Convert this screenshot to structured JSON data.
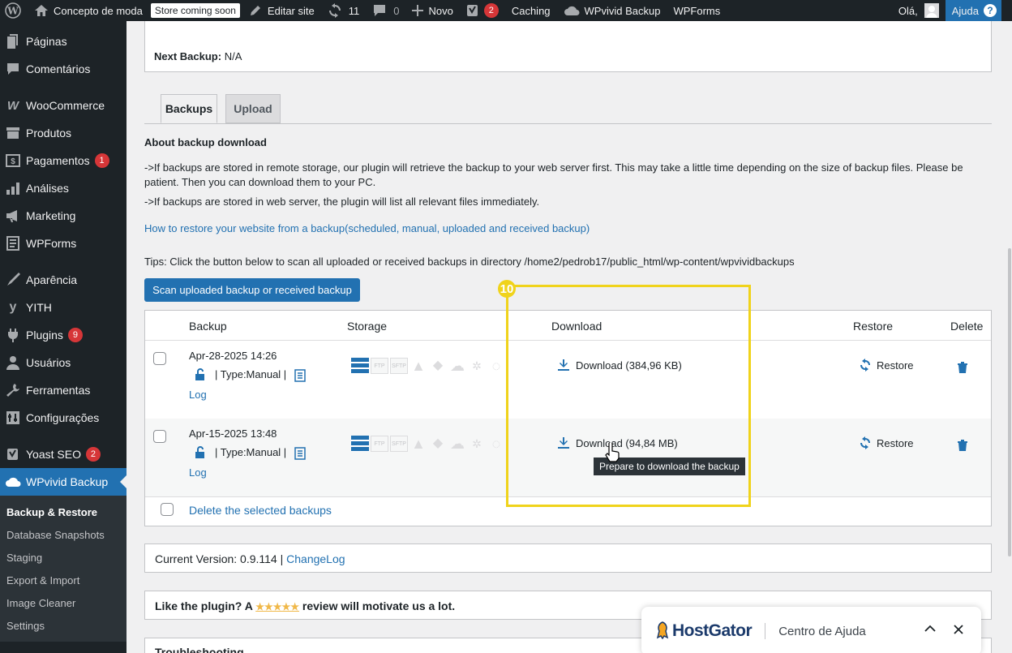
{
  "adminbar": {
    "site_name": "Concepto de moda",
    "store_badge": "Store coming soon",
    "edit_site": "Editar site",
    "updates_count": "11",
    "comments_count": "0",
    "new_label": "Novo",
    "yoast_count": "2",
    "caching": "Caching",
    "wpvivid": "WPvivid Backup",
    "wpforms": "WPForms",
    "greeting": "Olá,",
    "help": "Ajuda"
  },
  "sidebar": {
    "items": [
      {
        "label": "Páginas",
        "icon": "pages-icon"
      },
      {
        "label": "Comentários",
        "icon": "comments-icon"
      },
      {
        "label": "WooCommerce",
        "icon": "woocommerce-icon"
      },
      {
        "label": "Produtos",
        "icon": "products-icon"
      },
      {
        "label": "Pagamentos",
        "icon": "payments-icon",
        "badge": "1"
      },
      {
        "label": "Análises",
        "icon": "analytics-icon"
      },
      {
        "label": "Marketing",
        "icon": "marketing-icon"
      },
      {
        "label": "WPForms",
        "icon": "wpforms-icon"
      },
      {
        "label": "Aparência",
        "icon": "appearance-icon"
      },
      {
        "label": "YITH",
        "icon": "yith-icon"
      },
      {
        "label": "Plugins",
        "icon": "plugins-icon",
        "badge": "9"
      },
      {
        "label": "Usuários",
        "icon": "users-icon"
      },
      {
        "label": "Ferramentas",
        "icon": "tools-icon"
      },
      {
        "label": "Configurações",
        "icon": "settings-icon"
      },
      {
        "label": "Yoast SEO",
        "icon": "yoast-icon",
        "badge": "2"
      },
      {
        "label": "WPvivid Backup",
        "icon": "cloud-icon"
      }
    ],
    "submenu": [
      "Backup & Restore",
      "Database Snapshots",
      "Staging",
      "Export & Import",
      "Image Cleaner",
      "Settings"
    ]
  },
  "main": {
    "next_backup_label": "Next Backup:",
    "next_backup_value": "N/A",
    "tabs": [
      "Backups",
      "Upload"
    ],
    "about_title": "About backup download",
    "about_line1": "->If backups are stored in remote storage, our plugin will retrieve the backup to your web server first. This may take a little time depending on the size of backup files. Please be patient. Then you can download them to your PC.",
    "about_line2": "->If backups are stored in web server, the plugin will list all relevant files immediately.",
    "howto_link": "How to restore your website from a backup(scheduled, manual, uploaded and received backup)",
    "tips": "Tips: Click the button below to scan all uploaded or received backups in directory /home2/pedrob17/public_html/wp-content/wpvividbackups",
    "scan_button": "Scan uploaded backup or received backup",
    "table_headers": [
      "Backup",
      "Storage",
      "Download",
      "Restore",
      "Delete"
    ],
    "rows": [
      {
        "date": "Apr-28-2025 14:26",
        "type": "| Type:Manual |",
        "log": "Log",
        "download": "Download (384,96 KB)",
        "restore": "Restore"
      },
      {
        "date": "Apr-15-2025 13:48",
        "type": "| Type:Manual |",
        "log": "Log",
        "download": "Download (94,84 MB)",
        "restore": "Restore"
      }
    ],
    "storage_labels": {
      "ftp": "FTP",
      "sftp": "SFTP"
    },
    "delete_selected": "Delete the selected backups",
    "tooltip": "Prepare to download the backup",
    "highlight_number": "10",
    "version_label": "Current Version: 0.9.114",
    "version_sep": "|",
    "changelog": "ChangeLog",
    "review_prefix": "Like the plugin? A",
    "review_stars": "★★★★★",
    "review_suffix": "review will motivate us a lot.",
    "troubleshooting": "Troubleshooting"
  },
  "hostgator": {
    "brand": "HostGator",
    "title": "Centro de Ajuda"
  },
  "colors": {
    "accent": "#2271b1",
    "highlight": "#f0d31b",
    "admin_bg": "#1d2327",
    "badge": "#d63638"
  }
}
